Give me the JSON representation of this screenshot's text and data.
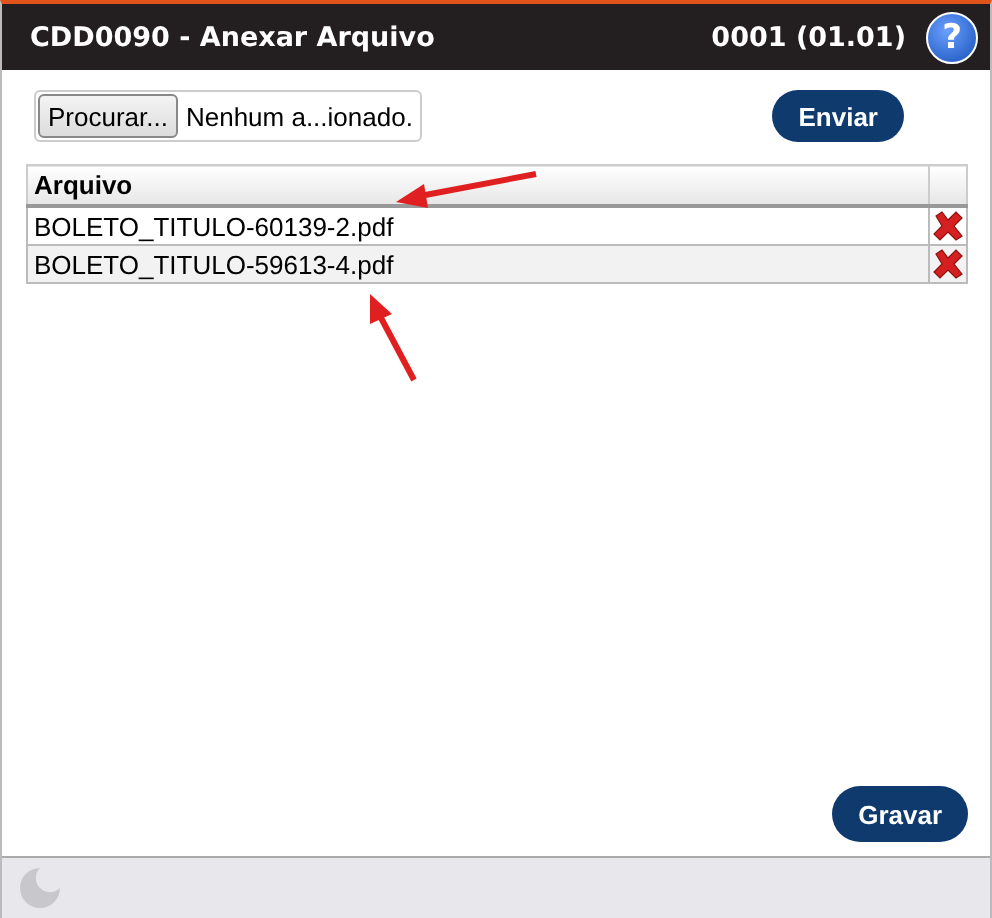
{
  "window": {
    "title": "CDD0090 - Anexar Arquivo",
    "code": "0001 (01.01)",
    "help": "?"
  },
  "upload": {
    "browse_button": "Procurar...",
    "file_status": "Nenhum a...ionado.",
    "send_button": "Enviar"
  },
  "table": {
    "columns": [
      "Arquivo"
    ],
    "rows": [
      {
        "file": "BOLETO_TITULO-60139-2.pdf"
      },
      {
        "file": "BOLETO_TITULO-59613-4.pdf"
      }
    ]
  },
  "save_button": "Gravar"
}
